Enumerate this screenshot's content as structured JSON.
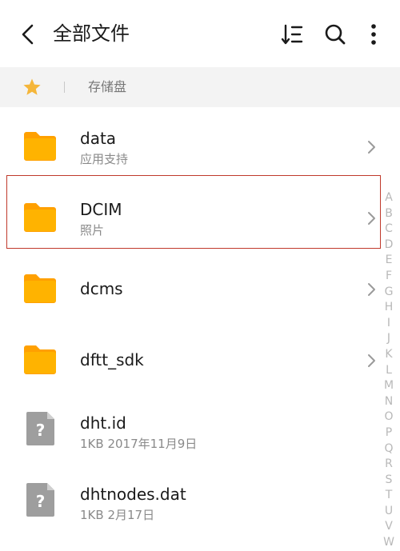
{
  "header": {
    "title": "全部文件"
  },
  "breadcrumb": {
    "label": "存储盘"
  },
  "files": [
    {
      "name": "data",
      "sub": "应用支持",
      "kind": "folder"
    },
    {
      "name": "DCIM",
      "sub": "照片",
      "kind": "folder",
      "selected": true
    },
    {
      "name": "dcms",
      "sub": "",
      "kind": "folder"
    },
    {
      "name": "dftt_sdk",
      "sub": "",
      "kind": "folder"
    },
    {
      "name": "dht.id",
      "sub": "1KB  2017年11月9日",
      "kind": "file"
    },
    {
      "name": "dhtnodes.dat",
      "sub": "1KB  2月17日",
      "kind": "file"
    }
  ],
  "alphabet": [
    "A",
    "B",
    "C",
    "D",
    "E",
    "F",
    "G",
    "H",
    "I",
    "J",
    "K",
    "L",
    "M",
    "N",
    "O",
    "P",
    "Q",
    "R",
    "S",
    "T",
    "U",
    "V",
    "W"
  ],
  "colors": {
    "folder": "#FFB300",
    "folder_tab": "#FFA000",
    "star": "#F5B63A",
    "file_icon": "#9e9e9e",
    "selection_border": "#c0392b"
  },
  "icons": {
    "back": "chevron-left-icon",
    "sort": "sort-icon",
    "search": "search-icon",
    "more": "more-vertical-icon",
    "star": "star-icon",
    "folder": "folder-icon",
    "file": "unknown-file-icon",
    "chevron": "chevron-right-icon"
  }
}
